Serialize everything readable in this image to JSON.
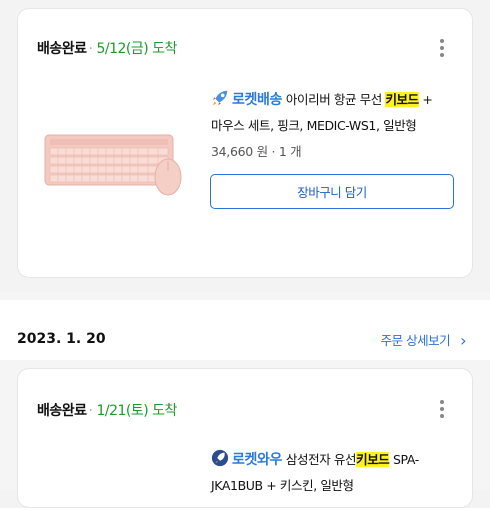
{
  "order1": {
    "status": "배송완료",
    "separator": "·",
    "date": "5/12(금) 도착",
    "badge": "로켓배송",
    "title_prefix": "아이리버 항균 무선 ",
    "title_highlight": "키보드",
    "title_suffix": " +",
    "title_line2": "마우스 세트, 핑크, MEDIC-WS1, 일반형",
    "price": "34,660 원 · 1 개",
    "cart_button": "장바구니 담기"
  },
  "order_header": {
    "date": "2023. 1. 20",
    "detail_link": "주문 상세보기",
    "chevron": "›"
  },
  "order2": {
    "status": "배송완료",
    "separator": "·",
    "date": "1/21(토) 도착",
    "badge": "로켓와우",
    "title_prefix": "삼성전자 유선",
    "title_highlight": "키보드",
    "title_suffix": " SPA-",
    "title_line2": "JKA1BUB + 키스킨, 일반형"
  },
  "colors": {
    "accent": "#2a72d5",
    "delivered_date": "#1e9b2a",
    "highlight": "#fff21f",
    "product_pink": "#f3c9c0"
  },
  "icons": [
    "rocket-icon",
    "kebab-menu-icon",
    "chevron-right-icon"
  ]
}
